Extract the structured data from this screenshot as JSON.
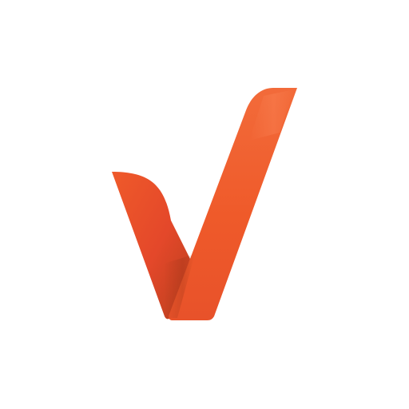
{
  "logo": {
    "icon": "checkmark-ribbon-icon",
    "colors": {
      "primary": "#EF5A2A",
      "highlight": "#F26B3A",
      "shadow": "#C8441E",
      "background": "#FFFFFF"
    }
  }
}
